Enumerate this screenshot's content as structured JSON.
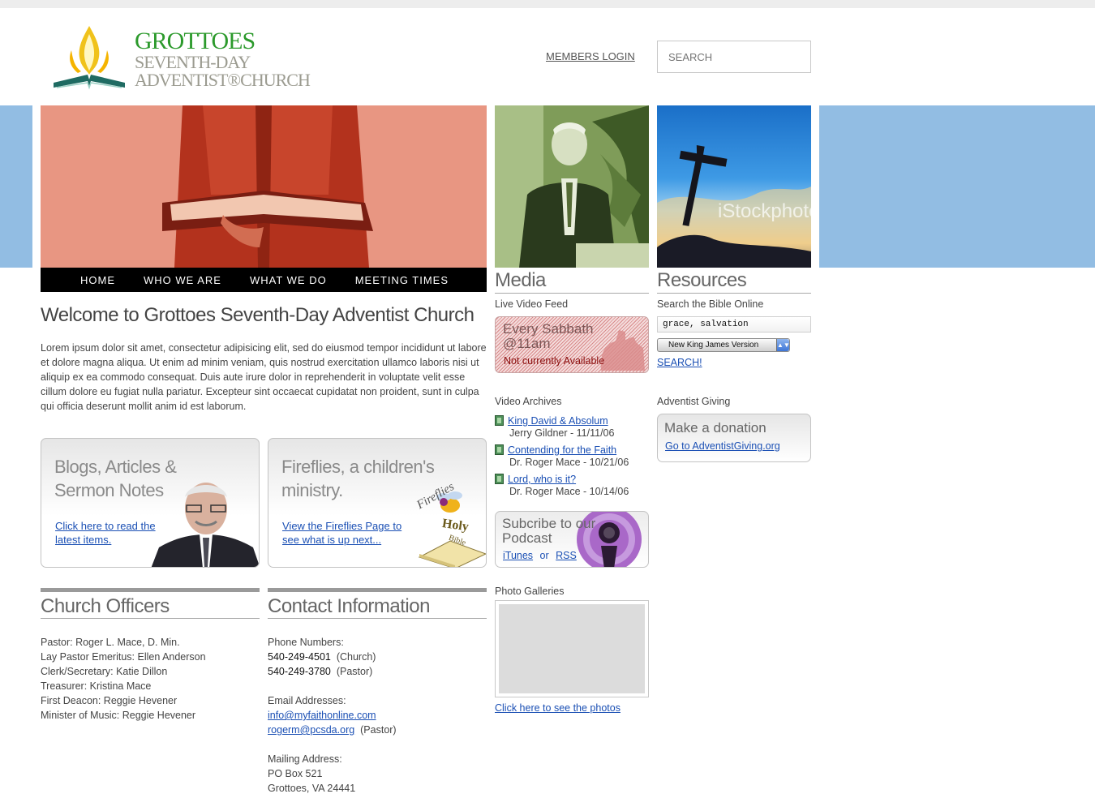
{
  "header": {
    "logo": {
      "line1": "Grottoes",
      "line2": "Seventh-day",
      "line3": "Adventist®Church"
    },
    "members_login": "MEMBERS LOGIN",
    "search_placeholder": "SEARCH"
  },
  "nav": [
    "HOME",
    "WHO WE ARE",
    "WHAT WE DO",
    "MEETING TIMES"
  ],
  "welcome": {
    "title": "Welcome to Grottoes Seventh-Day Adventist Church",
    "body": "Lorem ipsum dolor sit amet, consectetur adipisicing elit, sed do eiusmod tempor incididunt ut labore et dolore magna aliqua. Ut enim ad minim veniam, quis nostrud exercitation ullamco laboris nisi ut aliquip ex ea commodo consequat. Duis aute irure dolor in reprehenderit in voluptate velit esse cillum dolore eu fugiat nulla pariatur. Excepteur sint occaecat cupidatat non proident, sunt in culpa qui officia deserunt mollit anim id est laborum."
  },
  "cards": {
    "blogs": {
      "title": "Blogs, Articles & Sermon Notes",
      "link": "Click here to read the latest items."
    },
    "fireflies": {
      "title": "Fireflies, a children's ministry.",
      "link": "View the Fireflies Page to see what is up next...",
      "badge_top": "Fireflies",
      "badge_mid": "Holy",
      "badge_bot": "Bible"
    }
  },
  "officers": {
    "title": "Church Officers",
    "items": [
      "Pastor:  Roger L. Mace, D. Min.",
      "Lay Pastor Emeritus:  Ellen Anderson",
      "Clerk/Secretary:  Katie Dillon",
      "Treasurer:  Kristina Mace",
      "First Deacon:  Reggie Hevener",
      "Minister of Music:  Reggie Hevener"
    ]
  },
  "contact": {
    "title": "Contact Information",
    "phone_label": "Phone Numbers:",
    "phones": [
      {
        "number": "540-249-4501",
        "note": "(Church)"
      },
      {
        "number": "540-249-3780",
        "note": "(Pastor)"
      }
    ],
    "email_label": "Email Addresses:",
    "emails": [
      {
        "address": "info@myfaithonline.com",
        "note": ""
      },
      {
        "address": "rogerm@pcsda.org",
        "note": "(Pastor)"
      }
    ],
    "mail_label": "Mailing Address:",
    "mail_lines": [
      "PO Box 521",
      "Grottoes, VA  24441"
    ]
  },
  "media": {
    "title": "Media",
    "live_label": "Live Video Feed",
    "live_line1": "Every Sabbath",
    "live_line2": "@11am",
    "live_status": "Not currently Available",
    "archives_label": "Video Archives",
    "archives": [
      {
        "title": "King David & Absolum",
        "meta": "Jerry Gildner - 11/11/06"
      },
      {
        "title": "Contending for the Faith",
        "meta": "Dr. Roger Mace - 10/21/06"
      },
      {
        "title": "Lord, who is it?",
        "meta": "Dr. Roger Mace - 10/14/06"
      }
    ],
    "podcast_title": "Subcribe to our Podcast",
    "podcast_itunes": "iTunes",
    "podcast_or": "or",
    "podcast_rss": "RSS",
    "gallery_label": "Photo Galleries",
    "gallery_link": "Click here to see the photos"
  },
  "resources": {
    "title": "Resources",
    "bible_label": "Search the Bible Online",
    "bible_value": "grace, salvation",
    "version_value": "New King James Version",
    "search_link": "SEARCH!",
    "giving_label": "Adventist Giving",
    "donate_title": "Make a donation",
    "donate_link": "Go to AdventistGiving.org",
    "photo_watermark": "iStockphoto"
  }
}
